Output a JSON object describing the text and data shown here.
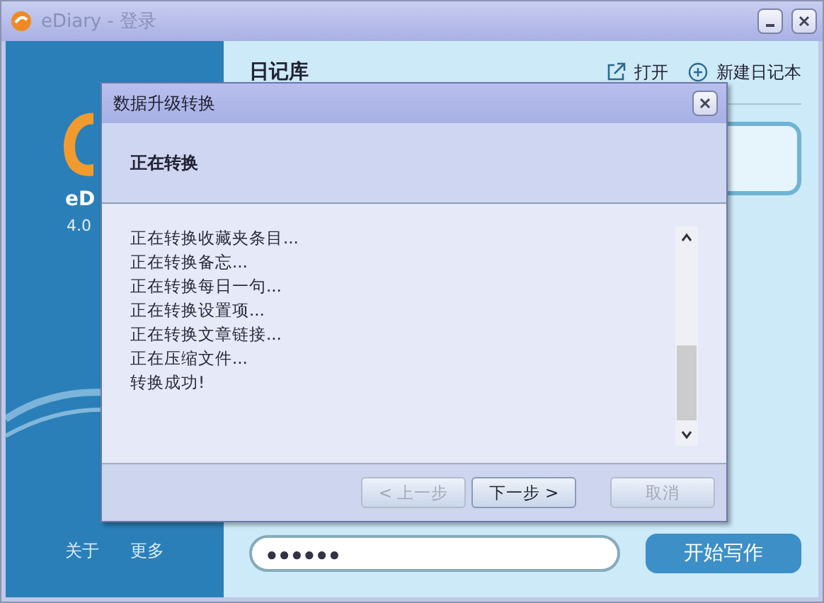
{
  "window": {
    "title": "eDiary - 登录"
  },
  "sidebar": {
    "app_name": "eD",
    "version": "4.0",
    "links": [
      "关于",
      "更多"
    ]
  },
  "library": {
    "title": "日记库",
    "actions": [
      {
        "kind": "open",
        "label": "打开"
      },
      {
        "kind": "new",
        "label": "新建日记本"
      }
    ]
  },
  "login": {
    "password_value": "●●●●●●",
    "submit": "开始写作"
  },
  "dialog": {
    "title": "数据升级转换",
    "heading": "正在转换",
    "log": [
      "正在转换收藏夹条目...",
      "正在转换备忘...",
      "正在转换每日一句...",
      "正在转换设置项...",
      "正在转换文章链接...",
      "正在压缩文件...",
      "转换成功!"
    ],
    "buttons": [
      {
        "label": "< 上一步",
        "disabled": true
      },
      {
        "label": "下一步 >",
        "disabled": false
      },
      {
        "label": "取消",
        "disabled": true
      }
    ]
  }
}
